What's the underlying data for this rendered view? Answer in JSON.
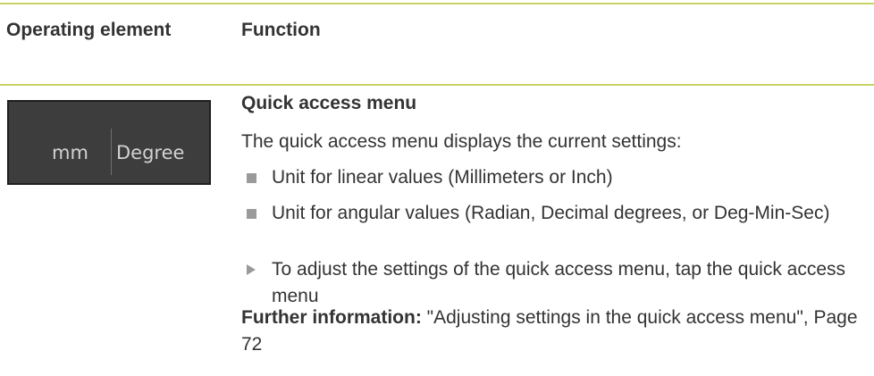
{
  "table": {
    "header": {
      "col1": "Operating element",
      "col2": "Function"
    },
    "widget": {
      "unit_linear": "mm",
      "unit_angular": "Degree"
    },
    "section_title": "Quick access menu",
    "intro": "The quick access menu displays the current settings:",
    "bullets": [
      "Unit for linear values (Millimeters or Inch)",
      "Unit for angular values (Radian, Decimal degrees, or Deg-Min-Sec)"
    ],
    "action": "To adjust the settings of the quick access menu, tap the quick access menu",
    "further_label": "Further information:",
    "further_text": " \"Adjusting settings in the quick access menu\", Page 72"
  },
  "colors": {
    "rule": "#c8d264",
    "widget_bg": "#3d3d3d",
    "text": "#333333"
  }
}
